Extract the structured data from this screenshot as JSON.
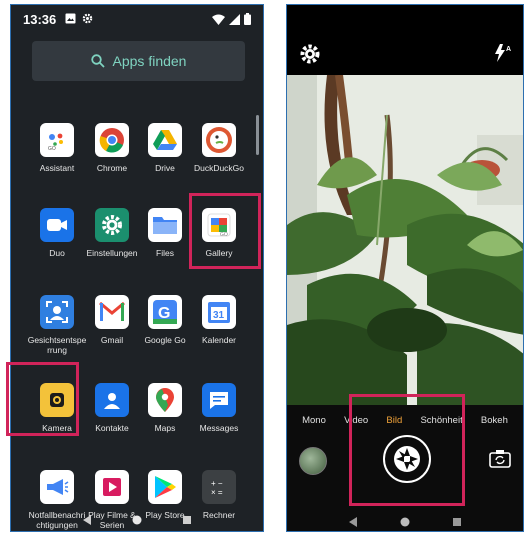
{
  "left_phone": {
    "status": {
      "time": "13:36",
      "notif_icons": [
        "image-icon",
        "gear-icon"
      ],
      "sys_icons": [
        "wifi-icon",
        "signal-icon",
        "battery-icon"
      ]
    },
    "search": {
      "label": "Apps finden",
      "icon": "search-icon"
    },
    "apps": [
      {
        "label": "Assistant",
        "icon": "assistant-icon",
        "bg": "#ffffff"
      },
      {
        "label": "Chrome",
        "icon": "chrome-icon",
        "bg": "#ffffff"
      },
      {
        "label": "Drive",
        "icon": "drive-icon",
        "bg": "#ffffff"
      },
      {
        "label": "DuckDuckGo",
        "icon": "duckduckgo-icon",
        "bg": "#ffffff"
      },
      {
        "label": "Duo",
        "icon": "duo-icon",
        "bg": "#1a73e8"
      },
      {
        "label": "Einstellungen",
        "icon": "settings-icon",
        "bg": "#1b8f6e"
      },
      {
        "label": "Files",
        "icon": "files-icon",
        "bg": "#ffffff"
      },
      {
        "label": "Gallery",
        "icon": "gallery-icon",
        "bg": "#ffffff"
      },
      {
        "label": "Gesichtsentsperrung",
        "icon": "face-unlock-icon",
        "bg": "#2f7fe0"
      },
      {
        "label": "Gmail",
        "icon": "gmail-icon",
        "bg": "#ffffff"
      },
      {
        "label": "Google Go",
        "icon": "google-go-icon",
        "bg": "#ffffff"
      },
      {
        "label": "Kalender",
        "icon": "calendar-icon",
        "bg": "#ffffff"
      },
      {
        "label": "Kamera",
        "icon": "camera-icon",
        "bg": "#f3c23a"
      },
      {
        "label": "Kontakte",
        "icon": "contacts-icon",
        "bg": "#1a73e8"
      },
      {
        "label": "Maps",
        "icon": "maps-icon",
        "bg": "#ffffff"
      },
      {
        "label": "Messages",
        "icon": "messages-icon",
        "bg": "#1a73e8"
      },
      {
        "label": "Notfallbenachrichtigungen",
        "display": "Notfallbenа\nchrichtigun..",
        "icon": "emergency-alert-icon",
        "bg": "#ffffff"
      },
      {
        "label": "Play Filme & Serien",
        "display": "Play Filme &\nSerien",
        "icon": "play-movies-icon",
        "bg": "#ffffff"
      },
      {
        "label": "Play Store",
        "icon": "play-store-icon",
        "bg": "#ffffff"
      },
      {
        "label": "Rechner",
        "icon": "calculator-icon",
        "bg": "#3c4043"
      }
    ],
    "nav": [
      "back-icon",
      "home-icon",
      "recents-icon"
    ]
  },
  "right_phone": {
    "top_icons": [
      "settings-gear-icon",
      "flash-auto-icon"
    ],
    "modes": [
      {
        "label": "Mono",
        "active": false
      },
      {
        "label": "Video",
        "active": false
      },
      {
        "label": "Bild",
        "active": true
      },
      {
        "label": "Schönheit",
        "active": false
      },
      {
        "label": "Bokeh",
        "active": false
      }
    ],
    "shutter_icon": "shutter-icon",
    "switch_camera_icon": "switch-camera-icon",
    "accent_color": "#f1a33a",
    "nav": [
      "back-icon",
      "home-icon",
      "recents-icon"
    ]
  },
  "highlight_color": "#d1245a"
}
